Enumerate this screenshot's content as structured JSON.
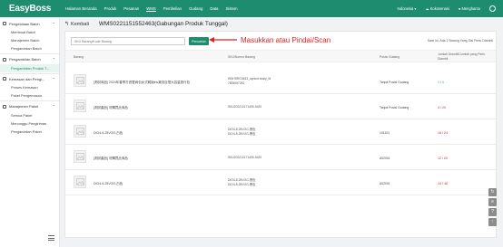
{
  "app": {
    "logo": "EasyBoss",
    "nav": [
      "Halaman Beranda",
      "Produk",
      "Pesanan",
      "WMS",
      "Pembelian",
      "Gudang",
      "Data",
      "Sistem"
    ],
    "active_nav": "WMS",
    "language": "Indonesia ▾",
    "notifications_label": "Kokosenasi",
    "user_label": "Menghantu"
  },
  "sidebar": {
    "groups": [
      {
        "label": "Pengelolaan Batch",
        "items": [
          "Membuat Batch",
          "Manajemen Batch",
          "Pengambilan Batch"
        ]
      },
      {
        "label": "Pengambilan Batch",
        "items": [
          "Pengambilan Produk T..."
        ]
      },
      {
        "label": "Kemasan dan Pengi...",
        "items": [
          "Proses Kemasan",
          "Paket Pengemasan"
        ]
      },
      {
        "label": "Manajemen Paket",
        "items": [
          "Semua Paket",
          "Menunggu Pengiriman",
          "Pengambilan Paket"
        ]
      }
    ],
    "active_item": "Pengambilan Produk T..."
  },
  "header": {
    "back_label": "Kembali",
    "order_title": "WMS0221151552463(Gabungan Produk Tunggal)"
  },
  "search": {
    "placeholder": "SKU Barang/Kode Barang",
    "button_label": "Pencarian"
  },
  "annotation": {
    "text": "Masukkan atau Pindai/Scan",
    "color": "#e02020"
  },
  "hint": "Saat Ini, Ada 1 Barang Yang Sisi Perlu Diambil",
  "table": {
    "headers": {
      "product": "Barang",
      "sku": "SKU/Nomor Barang",
      "rack": "Posisi Gudang",
      "qty": "Jumlah Diambil/Jumlah yang Perlu Diambil"
    },
    "rows": [
      {
        "name": "[測試商品] 2024年春季打底雙肩包女式韓版ins潮流百搭大容量旅行包",
        "sku1": "WSHSRG3453_apricot dusty_M",
        "sku2": "7805097281",
        "rack": "Tanpa Posisi Gudang",
        "picked": "1",
        "total": "1",
        "status": "ok"
      },
      {
        "name": "[測試產品] 勿購買此商品",
        "sku1": "SKU202212171450-9420",
        "sku2": "",
        "rack": "Tanpa Posisi Gudang",
        "picked": "4",
        "total": "20",
        "status": "bad"
      },
      {
        "name": "DIO4-5-25VOG-白色",
        "sku1": "DIO4-5-25VOG-黑色",
        "sku2": "DIO4-5-25VOG-黑色",
        "rack": "101101",
        "picked": "16",
        "total": "24",
        "status": "bad"
      },
      {
        "name": "[測試產品] 勿購買此商品",
        "sku1": "SKU202212171450-9420",
        "sku2": "",
        "rack": "A02001",
        "picked": "12",
        "total": "20",
        "status": "bad"
      },
      {
        "name": "DIO4-5-25VOG-白色",
        "sku1": "DIO4-5-25VOG-黑色",
        "sku2": "DIO4-5-25VOG-黑色",
        "rack": "A02001",
        "picked": "24",
        "total": "48",
        "status": "bad"
      }
    ]
  },
  "colors": {
    "brand": "#1e8c6e",
    "ok": "#1e8c6e",
    "bad": "#e02020"
  },
  "floating_tools": [
    "refresh-icon",
    "list-icon",
    "help-icon",
    "top-icon"
  ]
}
